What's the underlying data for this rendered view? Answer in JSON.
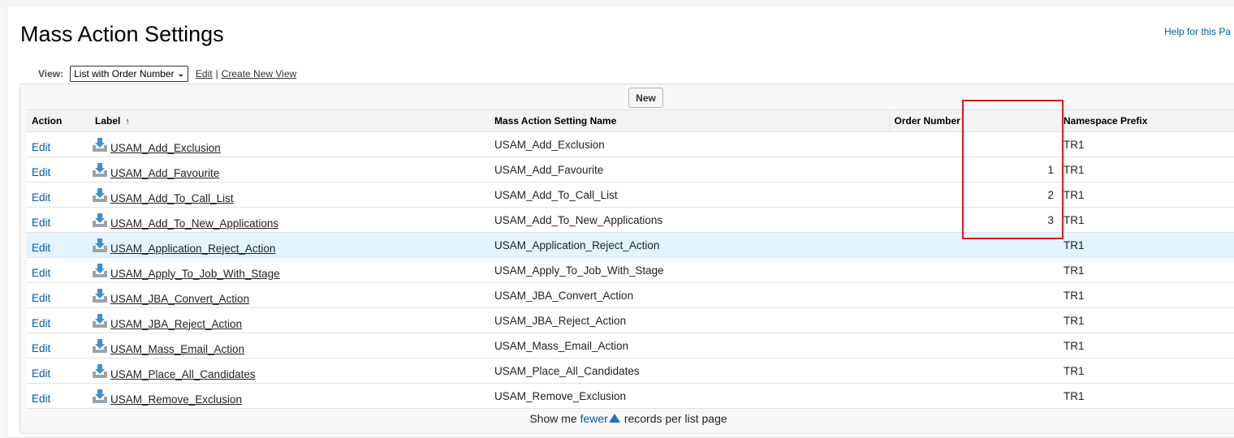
{
  "page": {
    "title": "Mass Action Settings",
    "help_link": "Help for this Pa"
  },
  "view": {
    "label": "View:",
    "selected": "List with Order Number",
    "edit_link": "Edit",
    "separator": "|",
    "create_link": "Create New View"
  },
  "toolbar": {
    "new_label": "New"
  },
  "table": {
    "headers": {
      "action": "Action",
      "label": "Label",
      "sort_indicator": "↑",
      "setting_name": "Mass Action Setting Name",
      "order_number": "Order Number",
      "namespace_prefix": "Namespace Prefix"
    },
    "rows": [
      {
        "action": "Edit",
        "label": "USAM_Add_Exclusion",
        "setting_name": "USAM_Add_Exclusion",
        "order": "",
        "prefix": "TR1"
      },
      {
        "action": "Edit",
        "label": "USAM_Add_Favourite",
        "setting_name": "USAM_Add_Favourite",
        "order": "1",
        "prefix": "TR1"
      },
      {
        "action": "Edit",
        "label": "USAM_Add_To_Call_List",
        "setting_name": "USAM_Add_To_Call_List",
        "order": "2",
        "prefix": "TR1"
      },
      {
        "action": "Edit",
        "label": "USAM_Add_To_New_Applications",
        "setting_name": "USAM_Add_To_New_Applications",
        "order": "3",
        "prefix": "TR1"
      },
      {
        "action": "Edit",
        "label": "USAM_Application_Reject_Action",
        "setting_name": "USAM_Application_Reject_Action",
        "order": "",
        "prefix": "TR1"
      },
      {
        "action": "Edit",
        "label": "USAM_Apply_To_Job_With_Stage",
        "setting_name": "USAM_Apply_To_Job_With_Stage",
        "order": "",
        "prefix": "TR1"
      },
      {
        "action": "Edit",
        "label": "USAM_JBA_Convert_Action",
        "setting_name": "USAM_JBA_Convert_Action",
        "order": "",
        "prefix": "TR1"
      },
      {
        "action": "Edit",
        "label": "USAM_JBA_Reject_Action",
        "setting_name": "USAM_JBA_Reject_Action",
        "order": "",
        "prefix": "TR1"
      },
      {
        "action": "Edit",
        "label": "USAM_Mass_Email_Action",
        "setting_name": "USAM_Mass_Email_Action",
        "order": "",
        "prefix": "TR1"
      },
      {
        "action": "Edit",
        "label": "USAM_Place_All_Candidates",
        "setting_name": "USAM_Place_All_Candidates",
        "order": "",
        "prefix": "TR1"
      },
      {
        "action": "Edit",
        "label": "USAM_Remove_Exclusion",
        "setting_name": "USAM_Remove_Exclusion",
        "order": "",
        "prefix": "TR1"
      }
    ],
    "highlighted_row": 4
  },
  "footer": {
    "prefix": "Show me",
    "link": "fewer",
    "suffix": "records per list page"
  },
  "colors": {
    "link_blue": "#015ba7",
    "row_highlight": "#e3f3ff",
    "annotation_red": "#e0141e"
  },
  "icons": {
    "row_icon": "download-icon",
    "footer_icon": "triangle-up-icon"
  }
}
